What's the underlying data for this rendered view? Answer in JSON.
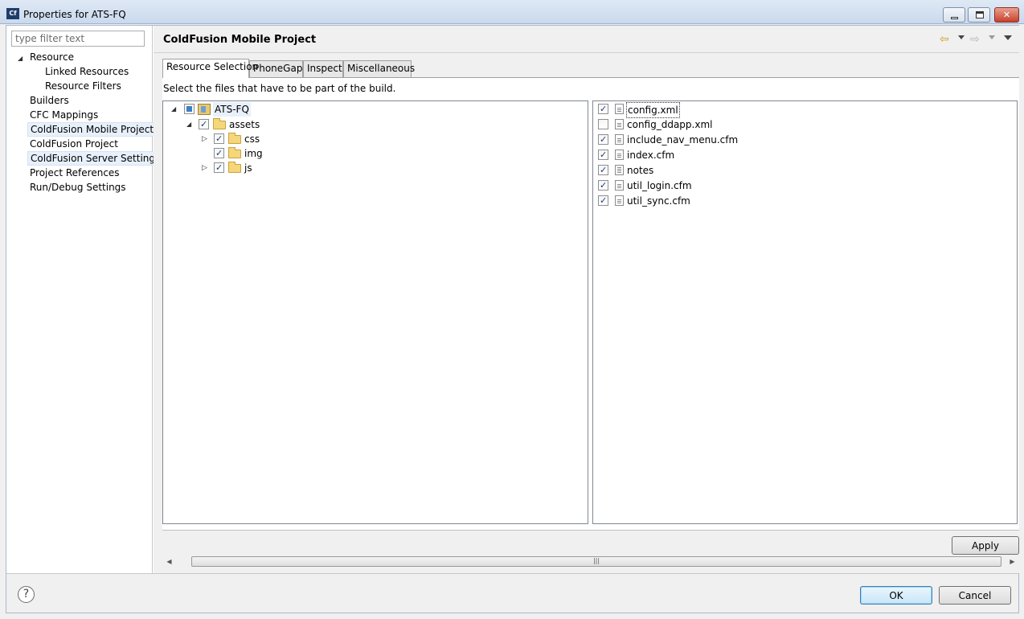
{
  "window": {
    "title": "Properties for ATS-FQ",
    "app_icon": "Cf"
  },
  "filter": {
    "placeholder": "type filter text"
  },
  "nav": {
    "items": [
      {
        "label": "Resource"
      },
      {
        "label": "Linked Resources"
      },
      {
        "label": "Resource Filters"
      },
      {
        "label": "Builders"
      },
      {
        "label": "CFC Mappings"
      },
      {
        "label": "ColdFusion Mobile Project"
      },
      {
        "label": "ColdFusion Project"
      },
      {
        "label": "ColdFusion Server Settings"
      },
      {
        "label": "Project References"
      },
      {
        "label": "Run/Debug Settings"
      }
    ]
  },
  "page": {
    "title": "ColdFusion Mobile Project"
  },
  "tabs": [
    {
      "label": "Resource Selection"
    },
    {
      "label": "PhoneGap"
    },
    {
      "label": "Inspect"
    },
    {
      "label": "Miscellaneous"
    }
  ],
  "instruction": "Select the files that have to be part of the build.",
  "tree": {
    "root": "ATS-FQ",
    "assets": "assets",
    "folders": [
      "css",
      "img",
      "js"
    ]
  },
  "files": [
    {
      "name": "config.xml",
      "checked": true
    },
    {
      "name": "config_ddapp.xml",
      "checked": false
    },
    {
      "name": "include_nav_menu.cfm",
      "checked": true
    },
    {
      "name": "index.cfm",
      "checked": true
    },
    {
      "name": "notes",
      "checked": true
    },
    {
      "name": "util_login.cfm",
      "checked": true
    },
    {
      "name": "util_sync.cfm",
      "checked": true
    }
  ],
  "buttons": {
    "apply": "Apply",
    "ok": "OK",
    "cancel": "Cancel"
  },
  "help": {
    "glyph": "?"
  }
}
